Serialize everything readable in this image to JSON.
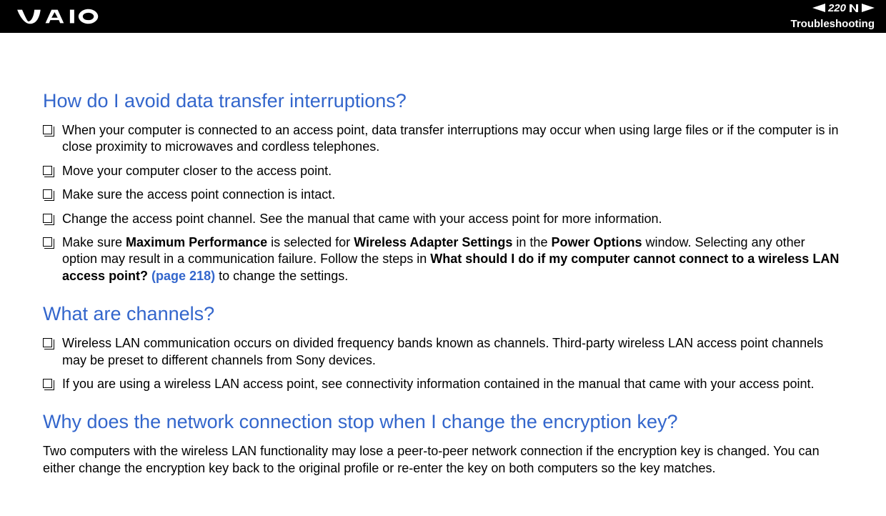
{
  "header": {
    "page_number": "220",
    "section": "Troubleshooting"
  },
  "sections": [
    {
      "heading": "How do I avoid data transfer interruptions?",
      "items": [
        {
          "text": "When your computer is connected to an access point, data transfer interruptions may occur when using large files or if the computer is in close proximity to microwaves and cordless telephones."
        },
        {
          "text": "Move your computer closer to the access point."
        },
        {
          "text": "Make sure the access point connection is intact."
        },
        {
          "text": "Change the access point channel. See the manual that came with your access point for more information."
        },
        {
          "pre": "Make sure ",
          "b1": "Maximum Performance",
          "mid1": " is selected for ",
          "b2": "Wireless Adapter Settings",
          "mid2": " in the ",
          "b3": "Power Options",
          "mid3": " window. Selecting any other option may result in a communication failure. Follow the steps in ",
          "b4": "What should I do if my computer cannot connect to a wireless LAN access point? ",
          "ref": "(page 218)",
          "post": " to change the settings."
        }
      ]
    },
    {
      "heading": "What are channels?",
      "items": [
        {
          "text": "Wireless LAN communication occurs on divided frequency bands known as channels. Third-party wireless LAN access point channels may be preset to different channels from Sony devices."
        },
        {
          "text": "If you are using a wireless LAN access point, see connectivity information contained in the manual that came with your access point."
        }
      ]
    },
    {
      "heading": "Why does the network connection stop when I change the encryption key?",
      "paragraph": "Two computers with the wireless LAN functionality may lose a peer-to-peer network connection if the encryption key is changed. You can either change the encryption key back to the original profile or re-enter the key on both computers so the key matches."
    }
  ]
}
